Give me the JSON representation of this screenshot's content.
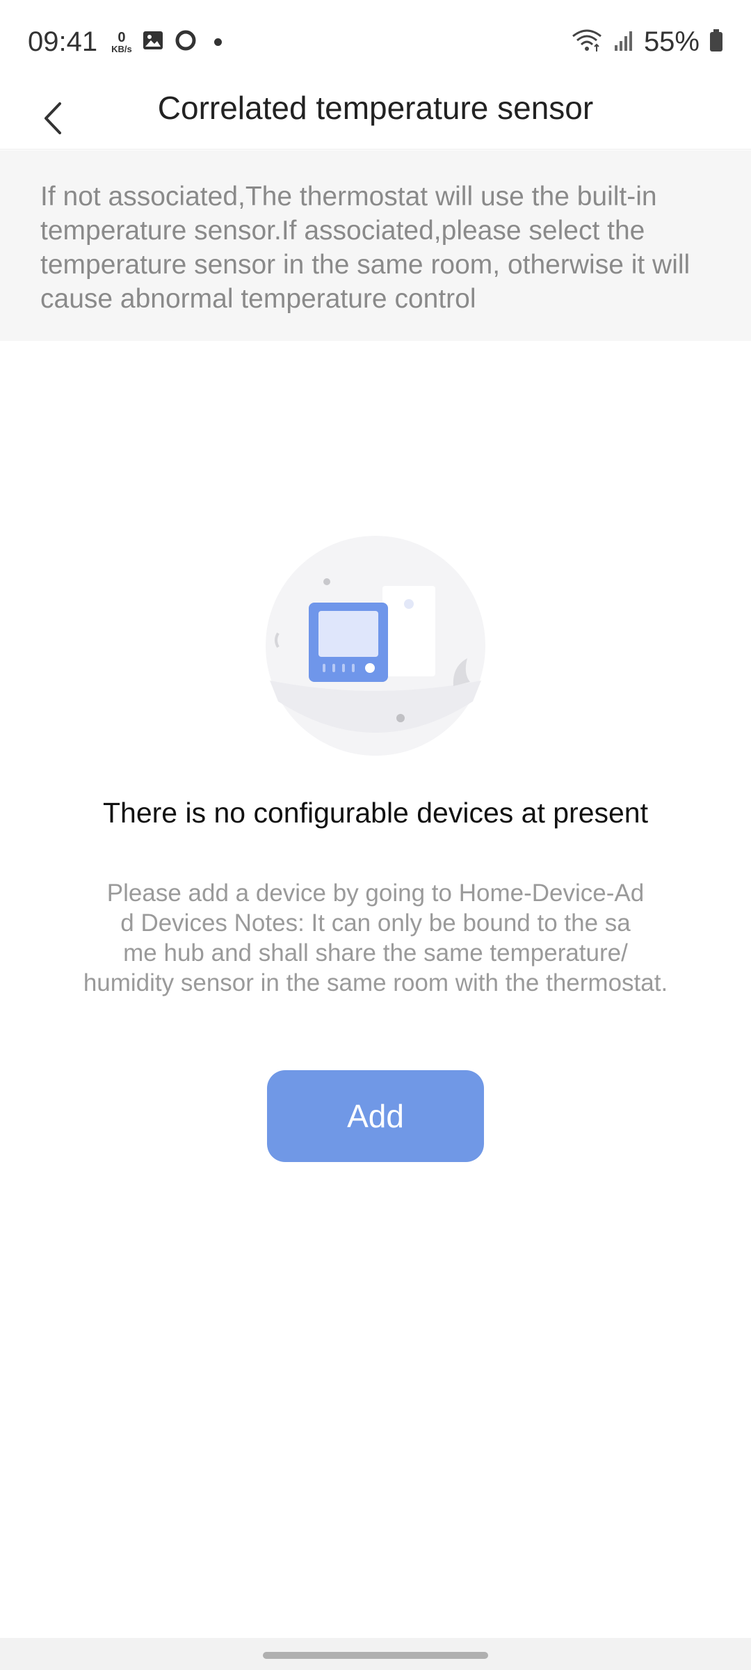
{
  "status_bar": {
    "time": "09:41",
    "speed_value": "0",
    "speed_unit": "KB/s",
    "battery_percent": "55%"
  },
  "header": {
    "title": "Correlated temperature sensor",
    "back_icon": "chevron-left-icon"
  },
  "notice": {
    "text": "If not associated,The thermostat will use the built-in temperature sensor.If associated,please select the temperature sensor in the same room, otherwise it will cause abnormal temperature control"
  },
  "empty_state": {
    "illustration": "thermostat-illustration",
    "title": "There is no configurable devices at present",
    "description_lines": [
      "Please add a device by going to Home-Device-Ad",
      "d Devices Notes: It can only be bound to the sa",
      "me hub and shall share the same temperature/",
      "humidity sensor in the same room with the thermostat."
    ]
  },
  "actions": {
    "add_label": "Add"
  },
  "colors": {
    "accent": "#7098e6",
    "notice_bg": "#f6f6f6",
    "notice_text": "#8a8a8a",
    "desc_text": "#9a9a9a"
  }
}
